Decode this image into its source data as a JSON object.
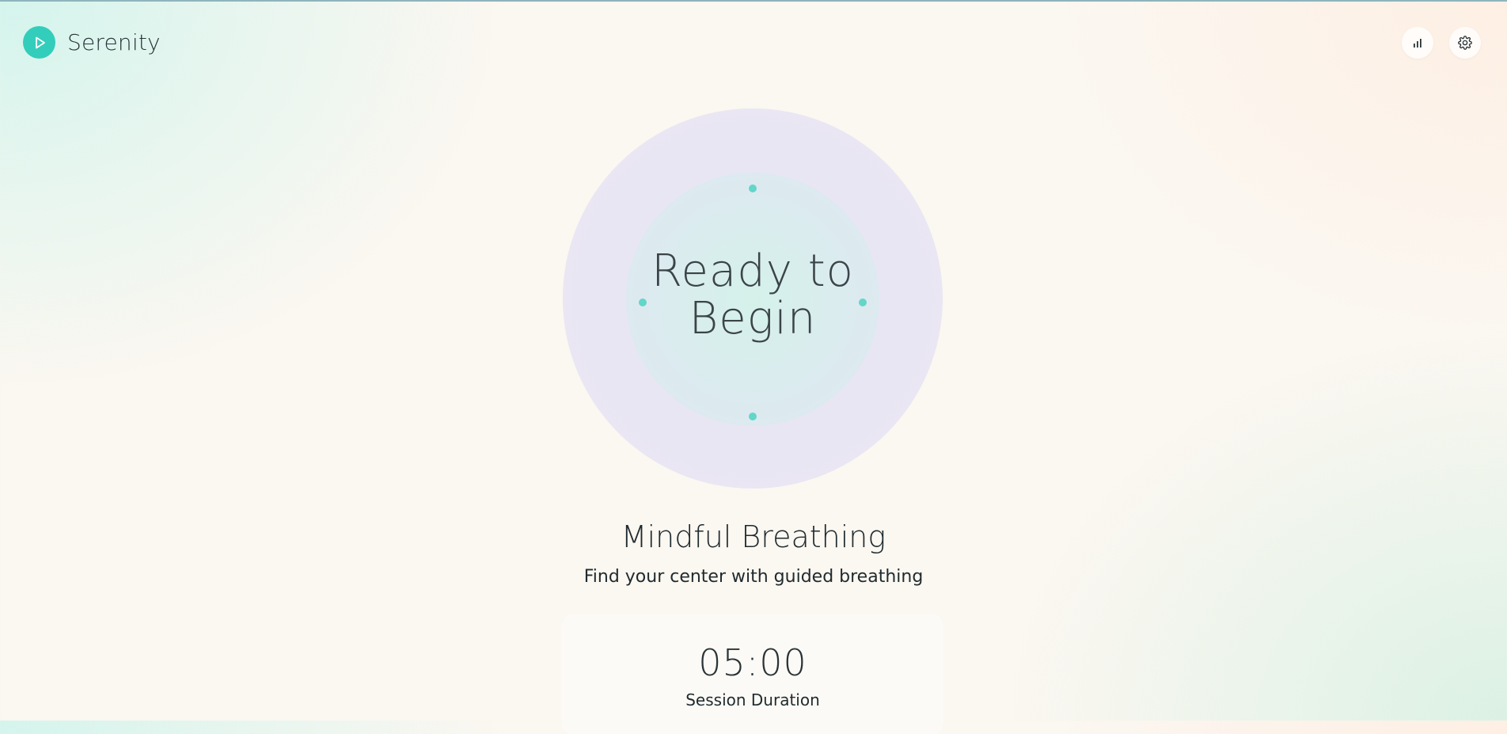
{
  "app": {
    "name": "Serenity",
    "logo_icon": "play-icon",
    "accent_color": "#33cdbb"
  },
  "header": {
    "actions": [
      {
        "name": "stats",
        "icon": "bar-chart-icon"
      },
      {
        "name": "settings",
        "icon": "gear-icon"
      }
    ]
  },
  "breathing_circle": {
    "status_line1": "Ready to",
    "status_line2": "Begin",
    "marker_color": "#62d6c8"
  },
  "session": {
    "title": "Mindful Breathing",
    "subtitle": "Find your center with guided breathing",
    "duration_value": "05:00",
    "duration_label": "Session Duration"
  }
}
